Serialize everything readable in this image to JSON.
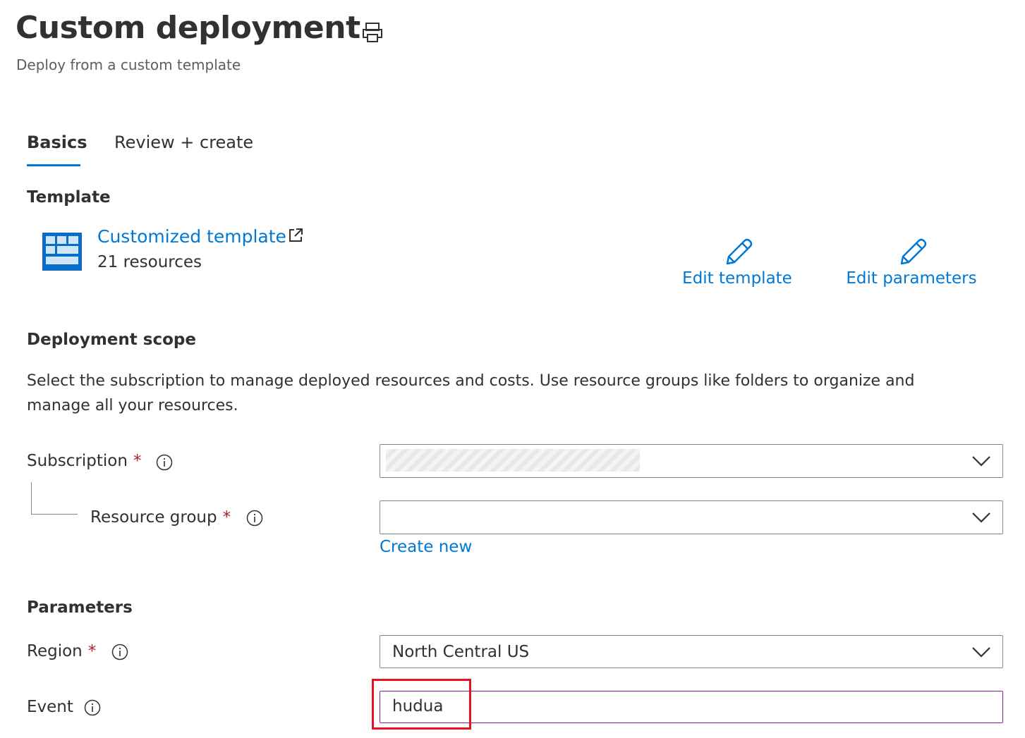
{
  "header": {
    "title": "Custom deployment",
    "subtitle": "Deploy from a custom template",
    "print_icon": "print-icon"
  },
  "tabs": [
    {
      "label": "Basics",
      "active": true
    },
    {
      "label": "Review + create",
      "active": false
    }
  ],
  "template_section": {
    "heading": "Template",
    "icon": "template-grid-icon",
    "link_label": "Customized template",
    "link_icon": "external-link-icon",
    "resource_count": "21 resources",
    "edit_template_label": "Edit template",
    "edit_parameters_label": "Edit parameters",
    "edit_icon": "pencil-icon"
  },
  "scope_section": {
    "heading": "Deployment scope",
    "description": "Select the subscription to manage deployed resources and costs. Use resource groups like folders to organize and manage all your resources.",
    "subscription": {
      "label": "Subscription",
      "required_mark": "*",
      "value": ""
    },
    "resource_group": {
      "label": "Resource group",
      "required_mark": "*",
      "value": ""
    },
    "create_new_label": "Create new"
  },
  "parameters_section": {
    "heading": "Parameters",
    "region": {
      "label": "Region",
      "required_mark": "*",
      "value": "North Central US"
    },
    "event": {
      "label": "Event",
      "value": "hudua"
    }
  },
  "colors": {
    "accent": "#0078d4",
    "required": "#a4262c",
    "focus_border": "#8a1f9e",
    "highlight": "#e81123"
  }
}
